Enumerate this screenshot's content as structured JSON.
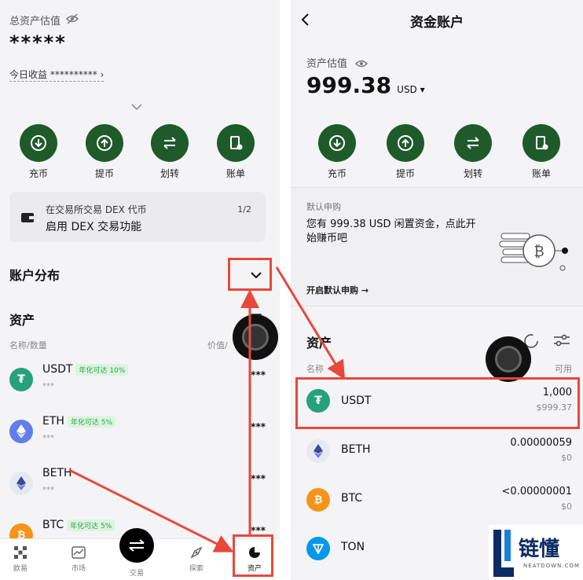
{
  "left": {
    "total_label": "总资产估值",
    "total_value": "*****",
    "today_label": "今日收益",
    "today_value": "**********",
    "actions": [
      {
        "label": "充币",
        "icon": "deposit-icon"
      },
      {
        "label": "提币",
        "icon": "withdraw-icon"
      },
      {
        "label": "划转",
        "icon": "transfer-icon"
      },
      {
        "label": "账单",
        "icon": "bill-icon"
      }
    ],
    "dex_banner": {
      "line1": "在交易所交易 DEX 代币",
      "line2": "启用 DEX 交易功能",
      "pager": "1/2"
    },
    "account_dist_label": "账户分布",
    "assets_title": "资产",
    "col_name": "名称/数量",
    "col_value": "价值/",
    "assets": [
      {
        "symbol": "USDT",
        "badge": "年化可达 10%",
        "amount": "***",
        "value": "***"
      },
      {
        "symbol": "ETH",
        "badge": "年化可达 5%",
        "amount": "***",
        "value": "***"
      },
      {
        "symbol": "BETH",
        "badge": "",
        "amount": "***",
        "value": "***"
      },
      {
        "symbol": "BTC",
        "badge": "年化可达 5%",
        "amount": "",
        "value": "***"
      }
    ],
    "nav": [
      {
        "label": "欧易",
        "icon": "okx-logo-icon"
      },
      {
        "label": "市场",
        "icon": "chart-icon"
      },
      {
        "label": "交易",
        "icon": "swap-icon"
      },
      {
        "label": "探索",
        "icon": "compass-icon"
      },
      {
        "label": "资产",
        "icon": "pie-chart-icon"
      }
    ]
  },
  "right": {
    "title": "资金账户",
    "valuation_label": "资产估值",
    "valuation_value": "999.38",
    "currency": "USD",
    "actions": [
      {
        "label": "充币",
        "icon": "deposit-icon"
      },
      {
        "label": "提币",
        "icon": "withdraw-icon"
      },
      {
        "label": "划转",
        "icon": "transfer-icon"
      },
      {
        "label": "账单",
        "icon": "bill-icon"
      }
    ],
    "earn": {
      "label": "默认申购",
      "text": "您有 999.38 USD 闲置资金，点此开始赚币吧",
      "link": "开启默认申购 →"
    },
    "assets_title": "资产",
    "col_name": "名称",
    "col_available": "可用",
    "assets": [
      {
        "symbol": "USDT",
        "amount": "1,000",
        "value": "$999.37"
      },
      {
        "symbol": "BETH",
        "amount": "0.00000059",
        "value": "$0"
      },
      {
        "symbol": "BTC",
        "amount": "<0.00000001",
        "value": "$0"
      },
      {
        "symbol": "TON",
        "amount": "",
        "value": ""
      }
    ]
  },
  "watermark": {
    "brand": "链懂",
    "domain": "NEATDOWN.COM"
  },
  "colors": {
    "action_green": "#1f5a2b",
    "highlight_red": "#e8483c",
    "badge_green": "#27a644",
    "usdt": "#26a17b",
    "eth": "#627eea",
    "btc": "#f7931a",
    "ton": "#0098ea"
  }
}
